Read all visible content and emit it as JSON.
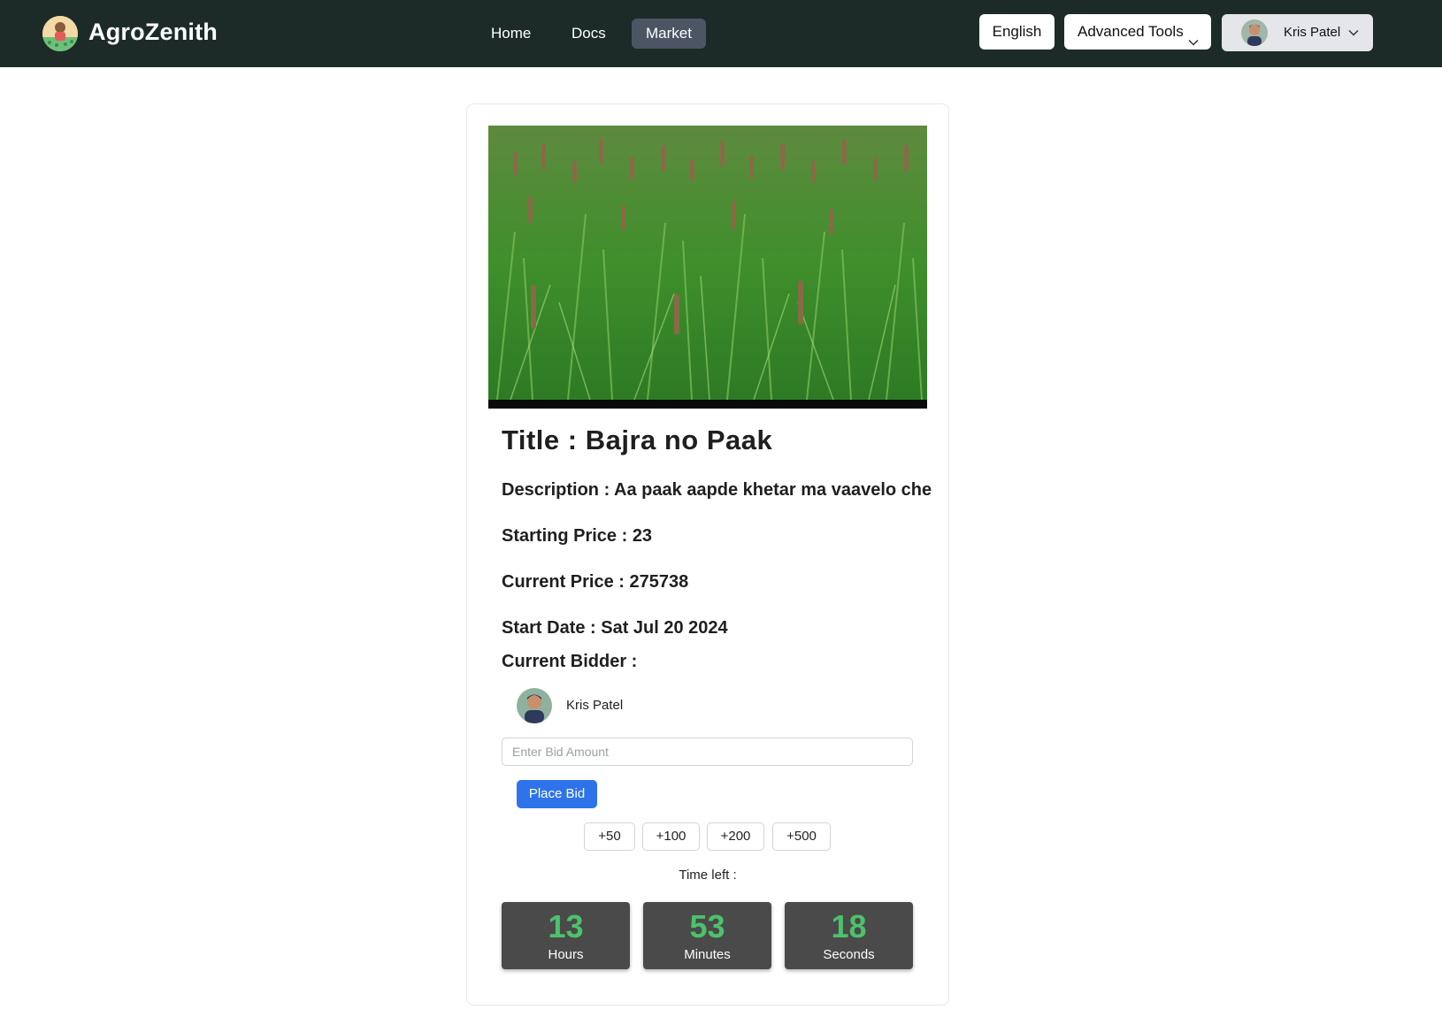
{
  "header": {
    "brand": "AgroZenith",
    "nav": [
      {
        "label": "Home"
      },
      {
        "label": "Docs"
      },
      {
        "label": "Market"
      }
    ],
    "active_nav": "Market",
    "language": "English",
    "tools_label": "Advanced Tools",
    "user_name": "Kris Patel"
  },
  "listing": {
    "title": "Title : Bajra no Paak",
    "description": "Description : Aa paak aapde khetar ma vaavelo che",
    "starting_price": "Starting Price : 23",
    "current_price": "Current Price : 275738",
    "start_date": "Start Date : Sat Jul 20 2024",
    "current_bidder_label": "Current Bidder :",
    "current_bidder_name": "Kris Patel"
  },
  "bid": {
    "placeholder": "Enter Bid Amount",
    "place_bid_label": "Place Bid",
    "increments": [
      "+50",
      "+100",
      "+200",
      "+500"
    ]
  },
  "countdown": {
    "label": "Time left :",
    "hours": "13",
    "hours_label": "Hours",
    "minutes": "53",
    "minutes_label": "Minutes",
    "seconds": "18",
    "seconds_label": "Seconds"
  },
  "colors": {
    "header_bg": "#1c2b28",
    "active_nav_bg": "#4c5563",
    "primary_button": "#2f73ea",
    "timer_box": "#4a4a4a",
    "timer_number": "#4cc26b"
  },
  "icons": {
    "logo": "farmer-logo-icon",
    "dropdown": "chevron-down-icon",
    "avatar": "user-avatar-icon"
  }
}
